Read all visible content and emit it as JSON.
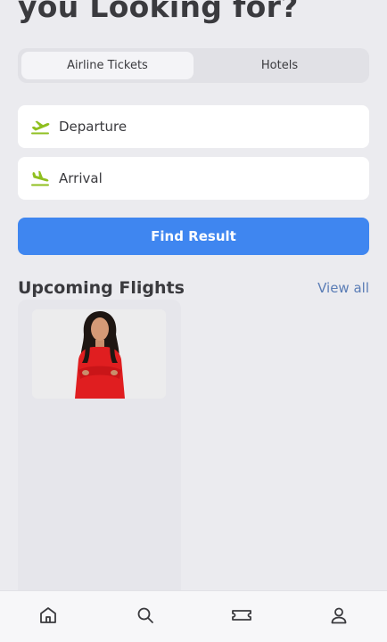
{
  "header": {
    "title": "you Looking for?"
  },
  "tabs": [
    {
      "label": "Airline Tickets",
      "active": true
    },
    {
      "label": "Hotels",
      "active": false
    }
  ],
  "form": {
    "departure_label": "Departure",
    "arrival_label": "Arrival",
    "submit_label": "Find Result"
  },
  "upcoming": {
    "title": "Upcoming Flights",
    "view_all_label": "View all"
  },
  "bottom_nav": {
    "items": [
      {
        "icon": "home-icon"
      },
      {
        "icon": "search-icon"
      },
      {
        "icon": "ticket-icon"
      },
      {
        "icon": "user-icon"
      }
    ]
  },
  "colors": {
    "accent": "#3f86f0",
    "icon_green": "#8fbf1f",
    "link": "#5b7db6",
    "background": "#ebebef"
  }
}
